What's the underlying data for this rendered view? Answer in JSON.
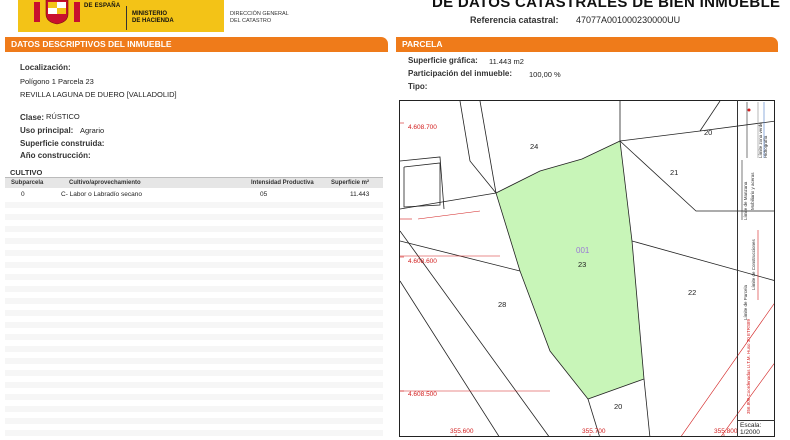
{
  "header": {
    "logo_line1": "DE ESPAÑA",
    "ministry_line1": "MINISTERIO",
    "ministry_line2": "DE HACIENDA",
    "dg_line1": "DIRECCIÓN GENERAL",
    "dg_line2": "DEL CATASTRO",
    "title": "DE DATOS CATASTRALES DE BIEN INMUEBLE",
    "ref_label": "Referencia catastral:",
    "ref_value": "47077A001000230000UU",
    "brand_color": "#f3c317",
    "accent_color": "#ef7b1a"
  },
  "left": {
    "section_title": "DATOS DESCRIPTIVOS DEL INMUEBLE",
    "localizacion_label": "Localización:",
    "localizacion_line1": "Polígono 1 Parcela 23",
    "localizacion_line2": "REVILLA  LAGUNA DE DUERO [VALLADOLID]",
    "clase_label": "Clase:",
    "clase_value": "RÚSTICO",
    "uso_label": "Uso principal:",
    "uso_value": "Agrario",
    "superficie_label": "Superficie construida:",
    "anio_label": "Año construcción:",
    "cultivo_title": "CULTIVO",
    "table": {
      "headers": [
        "Subparcela",
        "Cultivo/aprovechamiento",
        "Intensidad Productiva",
        "Superficie m²"
      ],
      "rows": [
        [
          "0",
          "C- Labor o Labradío secano",
          "05",
          "11.443"
        ]
      ]
    }
  },
  "right": {
    "section_title": "PARCELA",
    "sup_grafica_label": "Superficie gráfica:",
    "sup_grafica_value": "11.443 m2",
    "participacion_label": "Participación del inmueble:",
    "participacion_value": "100,00 %",
    "tipo_label": "Tipo:",
    "map": {
      "parcel_fill": "#c8f5b8",
      "parcel_labels": [
        "24",
        "20",
        "21",
        "22",
        "28",
        "20",
        "23"
      ],
      "subparcel_code": "001",
      "coord_labels": [
        "4.608.700",
        "4.608.600",
        "4.608.500",
        "355.600",
        "355.700",
        "355.800"
      ]
    },
    "legend": {
      "items": [
        "Límite de Manzana",
        "Límite de Parcela",
        "Límite de Construcciones",
        "Mobiliario y aceras",
        "Límite zona verde",
        "Hidrografía"
      ],
      "footer": "356.800 Coordenadas U.T.M. Huso 30 ETRS89",
      "scale_label": "Escala:",
      "scale_value": "1/2000"
    }
  }
}
